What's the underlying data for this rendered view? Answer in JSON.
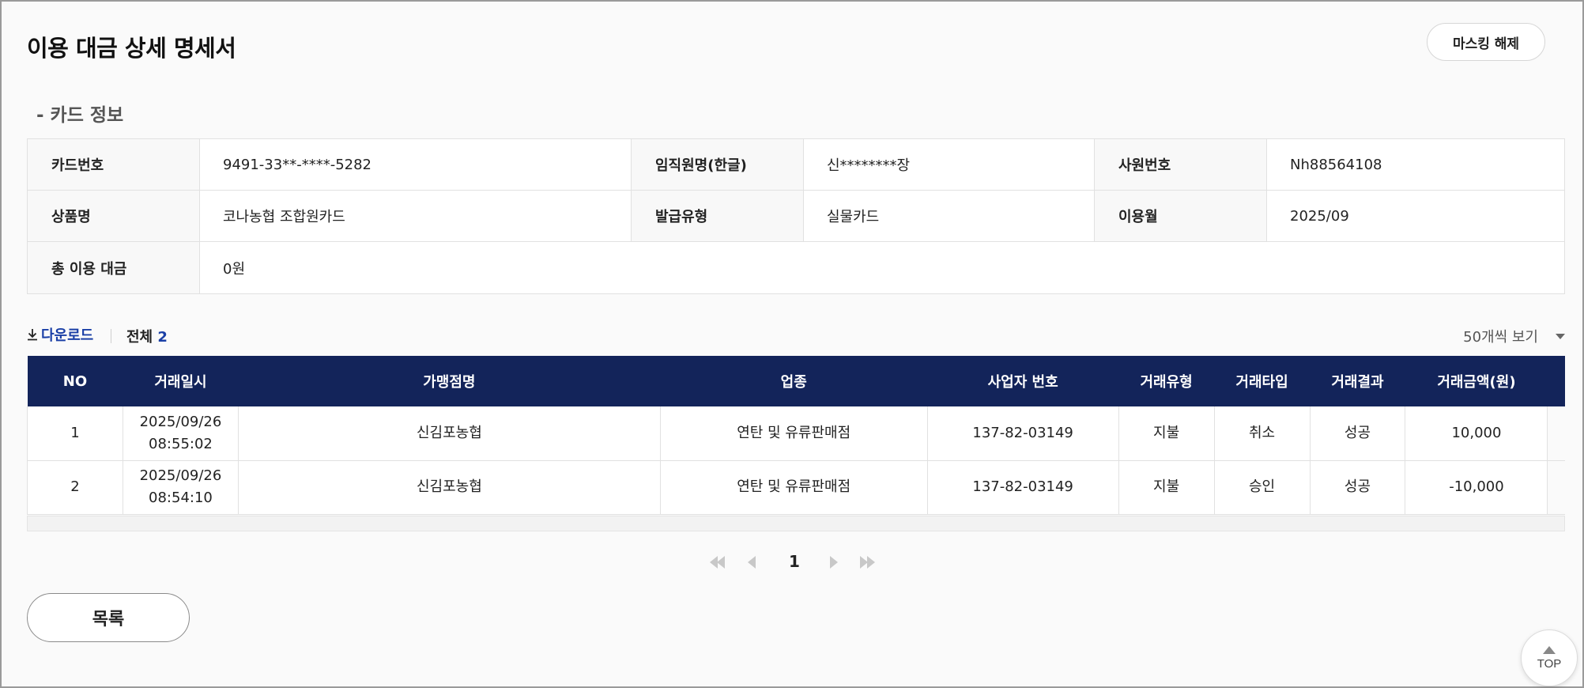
{
  "header": {
    "title": "이용 대금 상세 명세서",
    "unmask_label": "마스킹 해제"
  },
  "card_info": {
    "section_title": "- 카드 정보",
    "rows": [
      [
        {
          "label": "카드번호",
          "value": "9491-33**-****-5282"
        },
        {
          "label": "임직원명(한글)",
          "value": "신********장"
        },
        {
          "label": "사원번호",
          "value": "Nh88564108"
        }
      ],
      [
        {
          "label": "상품명",
          "value": "코나농협 조합원카드"
        },
        {
          "label": "발급유형",
          "value": "실물카드"
        },
        {
          "label": "이용월",
          "value": "2025/09"
        }
      ],
      [
        {
          "label": "총 이용 대금",
          "value": "0원"
        }
      ]
    ]
  },
  "toolbar": {
    "download_label": "다운로드",
    "total_label": "전체",
    "total_count": "2",
    "per_page_label": "50개씩 보기"
  },
  "transactions": {
    "columns": [
      "NO",
      "거래일시",
      "가맹점명",
      "업종",
      "사업자 번호",
      "거래유형",
      "거래타입",
      "거래결과",
      "거래금액(원)"
    ],
    "rows": [
      {
        "no": "1",
        "date": "2025/09/26",
        "time": "08:55:02",
        "merchant": "신김포농협",
        "industry": "연탄 및 유류판매점",
        "biz_no": "137-82-03149",
        "type": "지불",
        "kind": "취소",
        "result": "성공",
        "amount": "10,000"
      },
      {
        "no": "2",
        "date": "2025/09/26",
        "time": "08:54:10",
        "merchant": "신김포농협",
        "industry": "연탄 및 유류판매점",
        "biz_no": "137-82-03149",
        "type": "지불",
        "kind": "승인",
        "result": "성공",
        "amount": "-10,000"
      }
    ]
  },
  "pagination": {
    "current_page": "1"
  },
  "footer": {
    "list_label": "목록",
    "top_label": "TOP"
  },
  "colors": {
    "table_header": "#13245a",
    "accent_link": "#1a3fa6"
  },
  "icons": [
    "download-icon",
    "first-page-icon",
    "prev-page-icon",
    "next-page-icon",
    "last-page-icon",
    "chevron-down-icon",
    "arrow-up-icon"
  ]
}
